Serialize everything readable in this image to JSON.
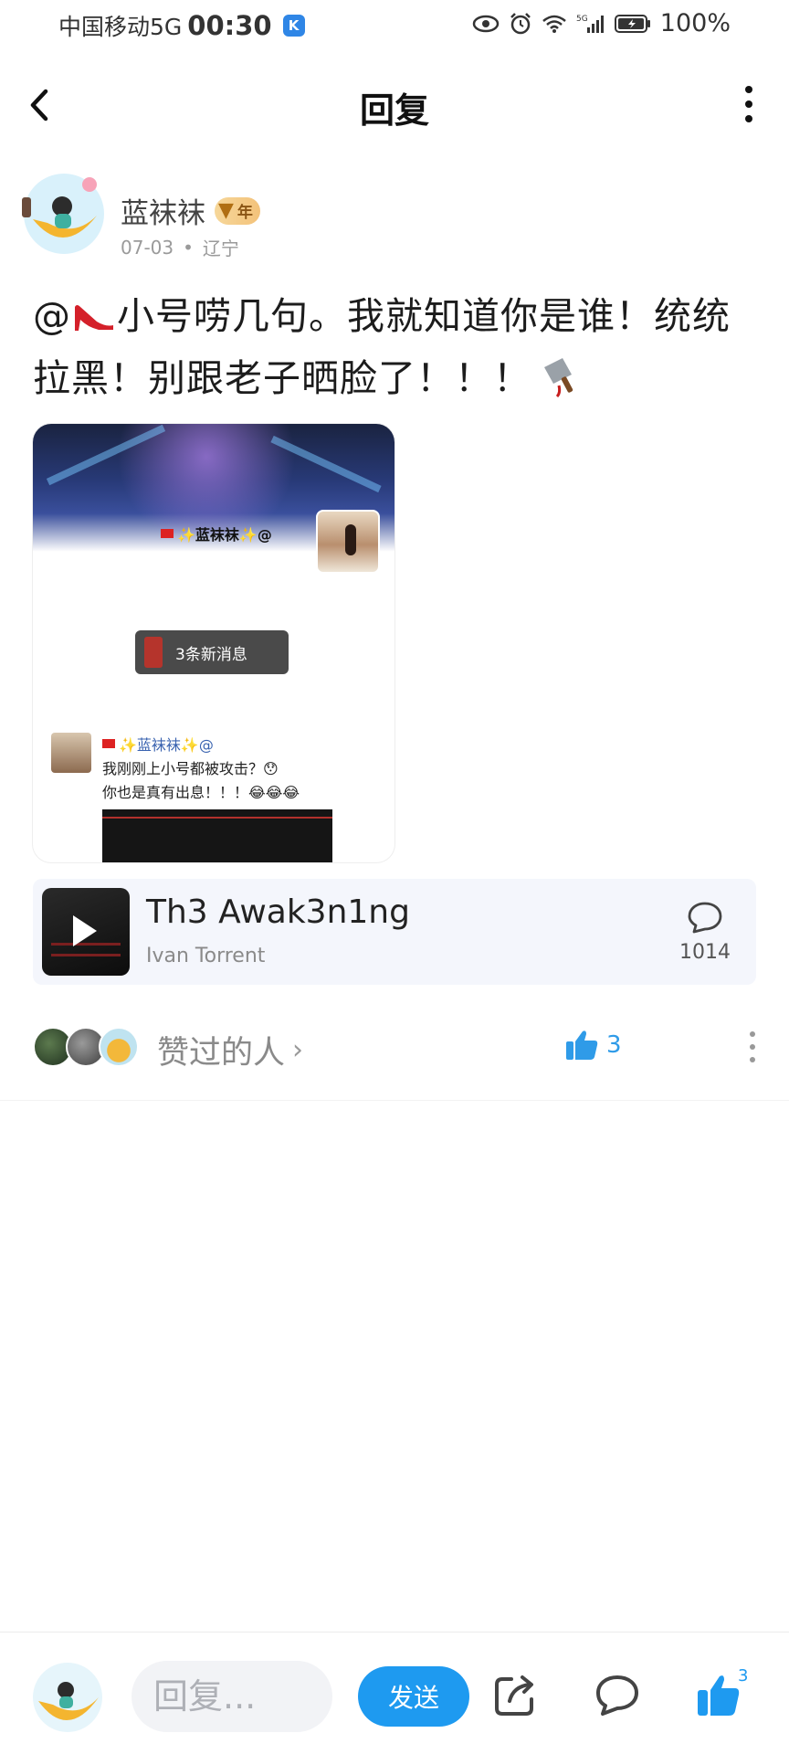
{
  "status_bar": {
    "carrier": "中国移动5G",
    "time": "00:30",
    "app_badge": "K",
    "network": "5G",
    "battery": "100%"
  },
  "header": {
    "title": "回复"
  },
  "post": {
    "author": "蓝袜袜",
    "vip_label": "年",
    "date": "07-03",
    "location": "辽宁",
    "text_at": "@",
    "text_body": "小号唠几句。我就知道你是谁！统统拉黑！别跟老子晒脸了！！！",
    "image": {
      "title_name": "✨蓝袜袜✨@",
      "new_msg": "3条新消息",
      "chat_name": "✨蓝袜袜✨@",
      "chat_line1": "我刚刚上小号都被攻击？😯",
      "chat_line2": "你也是真有出息！！！😂😂😂"
    }
  },
  "music": {
    "title": "Th3 Awak3n1ng",
    "artist": "Ivan Torrent",
    "comment_count": "1014"
  },
  "likes": {
    "label": "赞过的人",
    "chevron": "›",
    "count": "3"
  },
  "bottom_bar": {
    "reply_placeholder": "回复...",
    "send_label": "发送",
    "like_count": "3"
  },
  "colors": {
    "accent": "#1e9af0",
    "vip_gold": "#f3c27a"
  }
}
